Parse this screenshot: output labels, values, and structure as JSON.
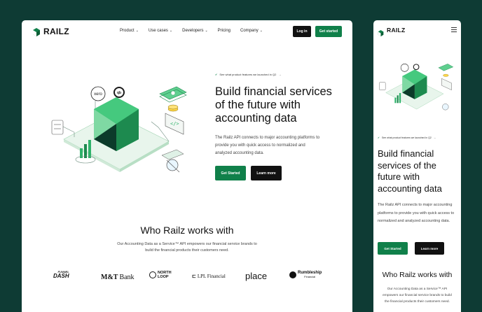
{
  "colors": {
    "background": "#0e3b34",
    "brand_green": "#10804a",
    "dark": "#111111"
  },
  "brand": {
    "name": "RAILZ",
    "logo_icon": "railz-cube-icon"
  },
  "desktop": {
    "nav": {
      "links": [
        {
          "label": "Product",
          "has_caret": true
        },
        {
          "label": "Use cases",
          "has_caret": true
        },
        {
          "label": "Developers",
          "has_caret": true
        },
        {
          "label": "Pricing",
          "has_caret": false
        },
        {
          "label": "Company",
          "has_caret": true
        }
      ],
      "login_label": "Log in",
      "get_started_label": "Get started"
    },
    "hero": {
      "announcement": "See what product features we launched in Q2",
      "title": "Build financial services of the future with accounting data",
      "description": "The Railz API connects to major accounting platforms to provide you with quick access to normalized and analyzed accounting data.",
      "primary_cta": "Get Started",
      "secondary_cta": "Learn more",
      "illustration_badges": [
        "xero",
        "qb"
      ]
    },
    "who": {
      "title": "Who Railz works with",
      "description": "Our Accounting Data as a Service™ API empowers our financial service brands to build the financial products their customers need.",
      "clients": [
        {
          "name": "FUNNEL DASH",
          "top": "FUNNEL",
          "bottom": "DASH"
        },
        {
          "name": "M&T Bank",
          "top": "M&T",
          "bottom": "Bank"
        },
        {
          "name": "NORTH LOOP",
          "top": "NORTH",
          "bottom": "LOOP"
        },
        {
          "name": "LPL Financial",
          "top": "LPL Financial",
          "bottom": ""
        },
        {
          "name": "place",
          "top": "place",
          "bottom": ""
        },
        {
          "name": "Rumbleship Financial",
          "top": "Rumbleship",
          "bottom": "Financial"
        }
      ]
    }
  },
  "mobile": {
    "menu_icon": "hamburger-icon",
    "hero": {
      "announcement": "See what product features we launched in Q2",
      "title": "Build financial services of the future with accounting data",
      "description": "The Railz API connects to major accounting platforms to provide you with quick access to normalized and analyzed accounting data.",
      "primary_cta": "Get Started",
      "secondary_cta": "Learn more"
    },
    "who": {
      "title": "Who Railz works with",
      "description": "Our Accounting Data as a Service™ API empowers our financial service brands to build the financial products their customers need."
    }
  }
}
